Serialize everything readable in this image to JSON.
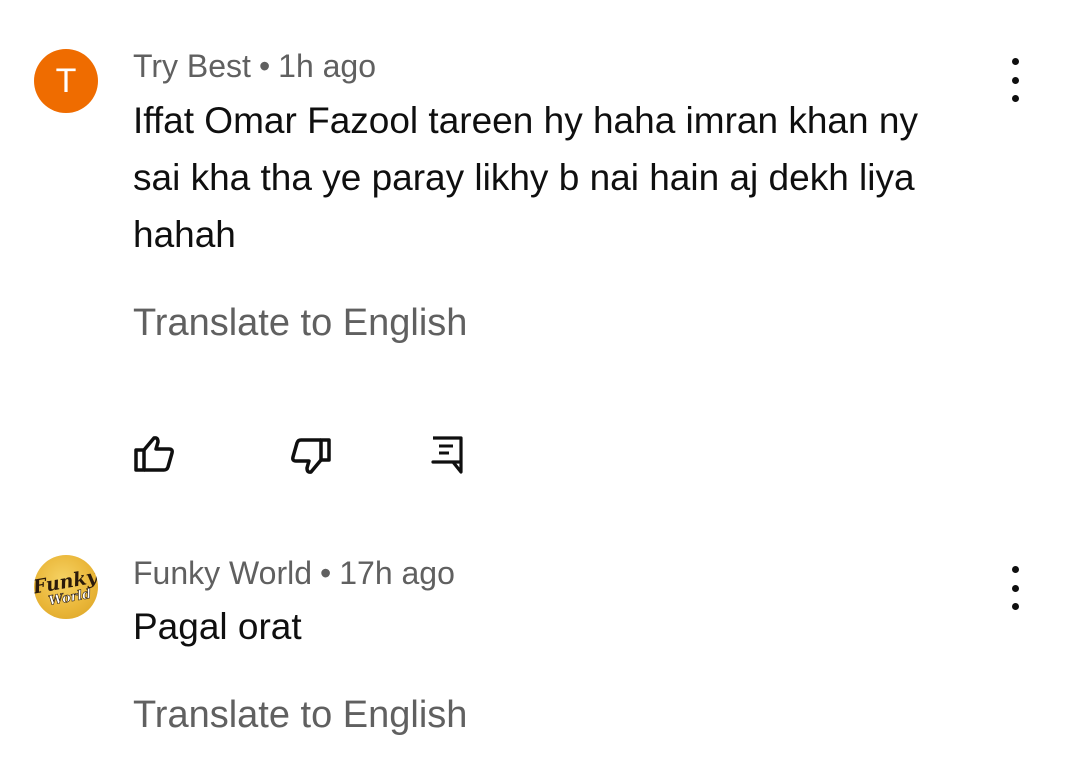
{
  "comments": [
    {
      "author": "Try Best",
      "separator": "•",
      "time": "1h ago",
      "avatar_letter": "T",
      "avatar_color": "#ef6c00",
      "lines": [
        "Iffat Omar Fazool tareen hy haha imran khan ny",
        "sai kha tha ye paray likhy b nai hain aj dekh liya",
        "hahah"
      ],
      "translate_label": "Translate to English"
    },
    {
      "author": "Funky World",
      "separator": "•",
      "time": "17h ago",
      "avatar_logo_text": [
        "Funky",
        "World"
      ],
      "avatar_color": "#eab73a",
      "lines": [
        "Pagal orat"
      ],
      "translate_label": "Translate to English"
    }
  ],
  "actions": [
    {
      "icon": "thumbs-up-icon"
    },
    {
      "icon": "thumbs-down-icon"
    },
    {
      "icon": "reply-icon"
    }
  ],
  "colors": {
    "text_primary": "#0f0f0f",
    "text_secondary": "#606060",
    "background": "#ffffff"
  }
}
